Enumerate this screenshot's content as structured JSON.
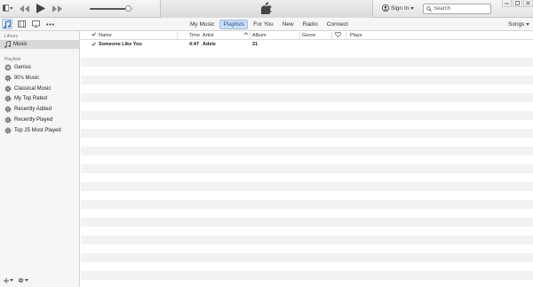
{
  "player": {
    "volume_fraction": 0.9
  },
  "account": {
    "sign_in_label": "Sign In"
  },
  "search": {
    "placeholder": "Search"
  },
  "nav": {
    "tabs": [
      {
        "label": "My Music",
        "active": false
      },
      {
        "label": "Playlists",
        "active": true
      },
      {
        "label": "For You",
        "active": false
      },
      {
        "label": "New",
        "active": false
      },
      {
        "label": "Radio",
        "active": false
      },
      {
        "label": "Connect",
        "active": false
      }
    ],
    "view_selector": "Songs"
  },
  "sidebar": {
    "library_heading": "Library",
    "library_items": [
      {
        "label": "Music",
        "icon": "music-note-icon",
        "selected": true
      }
    ],
    "playlists_heading": "Playlists",
    "playlist_items": [
      {
        "label": "Genius",
        "icon": "genius-icon"
      },
      {
        "label": "90's Music",
        "icon": "smart-playlist-gear-icon"
      },
      {
        "label": "Classical Music",
        "icon": "smart-playlist-gear-icon"
      },
      {
        "label": "My Top Rated",
        "icon": "smart-playlist-gear-icon"
      },
      {
        "label": "Recently Added",
        "icon": "smart-playlist-gear-icon"
      },
      {
        "label": "Recently Played",
        "icon": "smart-playlist-gear-icon"
      },
      {
        "label": "Top 25 Most Played",
        "icon": "smart-playlist-gear-icon"
      }
    ]
  },
  "table": {
    "columns": {
      "name": "Name",
      "time": "Time",
      "artist": "Artist",
      "album": "Album",
      "genre": "Genre",
      "plays": "Plays"
    },
    "rows": [
      {
        "checked": true,
        "name": "Someone Like You",
        "time": "4:47",
        "artist": "Adele",
        "album": "21",
        "genre": "",
        "plays": ""
      }
    ]
  },
  "colors": {
    "accent": "#cddff5",
    "selected_row": "#d9d9d9",
    "stripe": "#f2f2f2"
  }
}
